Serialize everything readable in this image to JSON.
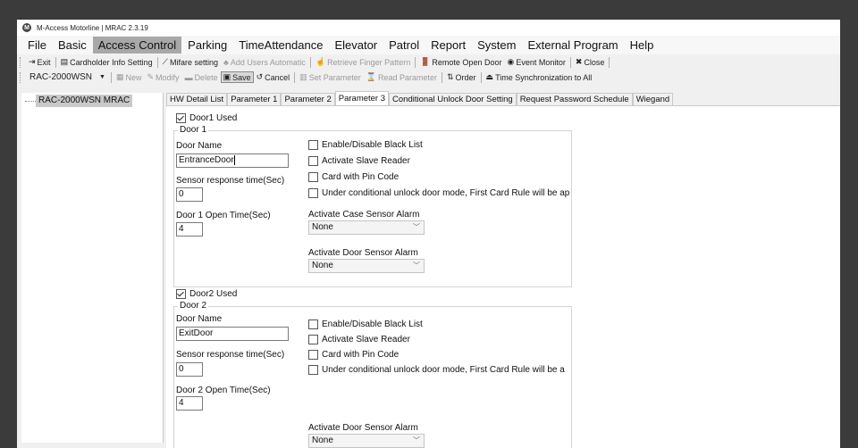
{
  "window": {
    "title": "M-Access Motorline | MRAC  2.3.19"
  },
  "menu": [
    "File",
    "Basic",
    "Access Control",
    "Parking",
    "TimeAttendance",
    "Elevator",
    "Patrol",
    "Report",
    "System",
    "External Program",
    "Help"
  ],
  "toolbar1": {
    "exit": "Exit",
    "cardholder": "Cardholder Info Setting",
    "mifare": "Mifare setting",
    "add_users": "Add Users Automatic",
    "retrieve_finger": "Retrieve Finger Pattern",
    "remote_open": "Remote Open Door",
    "event_monitor": "Event Monitor",
    "close": "Close"
  },
  "toolbar2": {
    "controller": "RAC-2000WSN",
    "new": "New",
    "modify": "Modify",
    "delete": "Delete",
    "save": "Save",
    "cancel": "Cancel",
    "set_parameter": "Set Parameter",
    "read_parameter": "Read Parameter",
    "order": "Order",
    "time_sync": "Time Synchronization to All"
  },
  "tree": {
    "node": "RAC-2000WSN  MRAC"
  },
  "tabs": [
    "HW Detail List",
    "Parameter 1",
    "Parameter 2",
    "Parameter 3",
    "Conditional Unlock Door Setting",
    "Request Password Schedule",
    "Wiegand"
  ],
  "door1": {
    "used_label": "Door1 Used",
    "group_label": "Door 1",
    "name_label": "Door Name",
    "name_value": "EntranceDoor",
    "sensor_label": "Sensor response time(Sec)",
    "sensor_value": "0",
    "open_time_label": "Door 1 Open Time(Sec)",
    "open_time_value": "4",
    "blacklist": "Enable/Disable Black List",
    "slave_reader": "Activate Slave Reader",
    "card_pin": "Card with Pin Code",
    "conditional": "Under conditional unlock door mode, First Card Rule will be ap",
    "case_alarm_label": "Activate Case Sensor Alarm",
    "case_alarm_value": "None",
    "door_alarm_label": "Activate Door Sensor Alarm",
    "door_alarm_value": "None"
  },
  "door2": {
    "used_label": "Door2 Used",
    "group_label": "Door 2",
    "name_label": "Door Name",
    "name_value": "ExitDoor",
    "sensor_label": "Sensor response time(Sec)",
    "sensor_value": "0",
    "open_time_label": "Door 2 Open Time(Sec)",
    "open_time_value": "4",
    "blacklist": "Enable/Disable Black List",
    "slave_reader": "Activate Slave Reader",
    "card_pin": "Card with Pin Code",
    "conditional": "Under conditional unlock door mode, First Card Rule will be a",
    "door_alarm_label": "Activate Door Sensor Alarm",
    "door_alarm_value": "None"
  }
}
